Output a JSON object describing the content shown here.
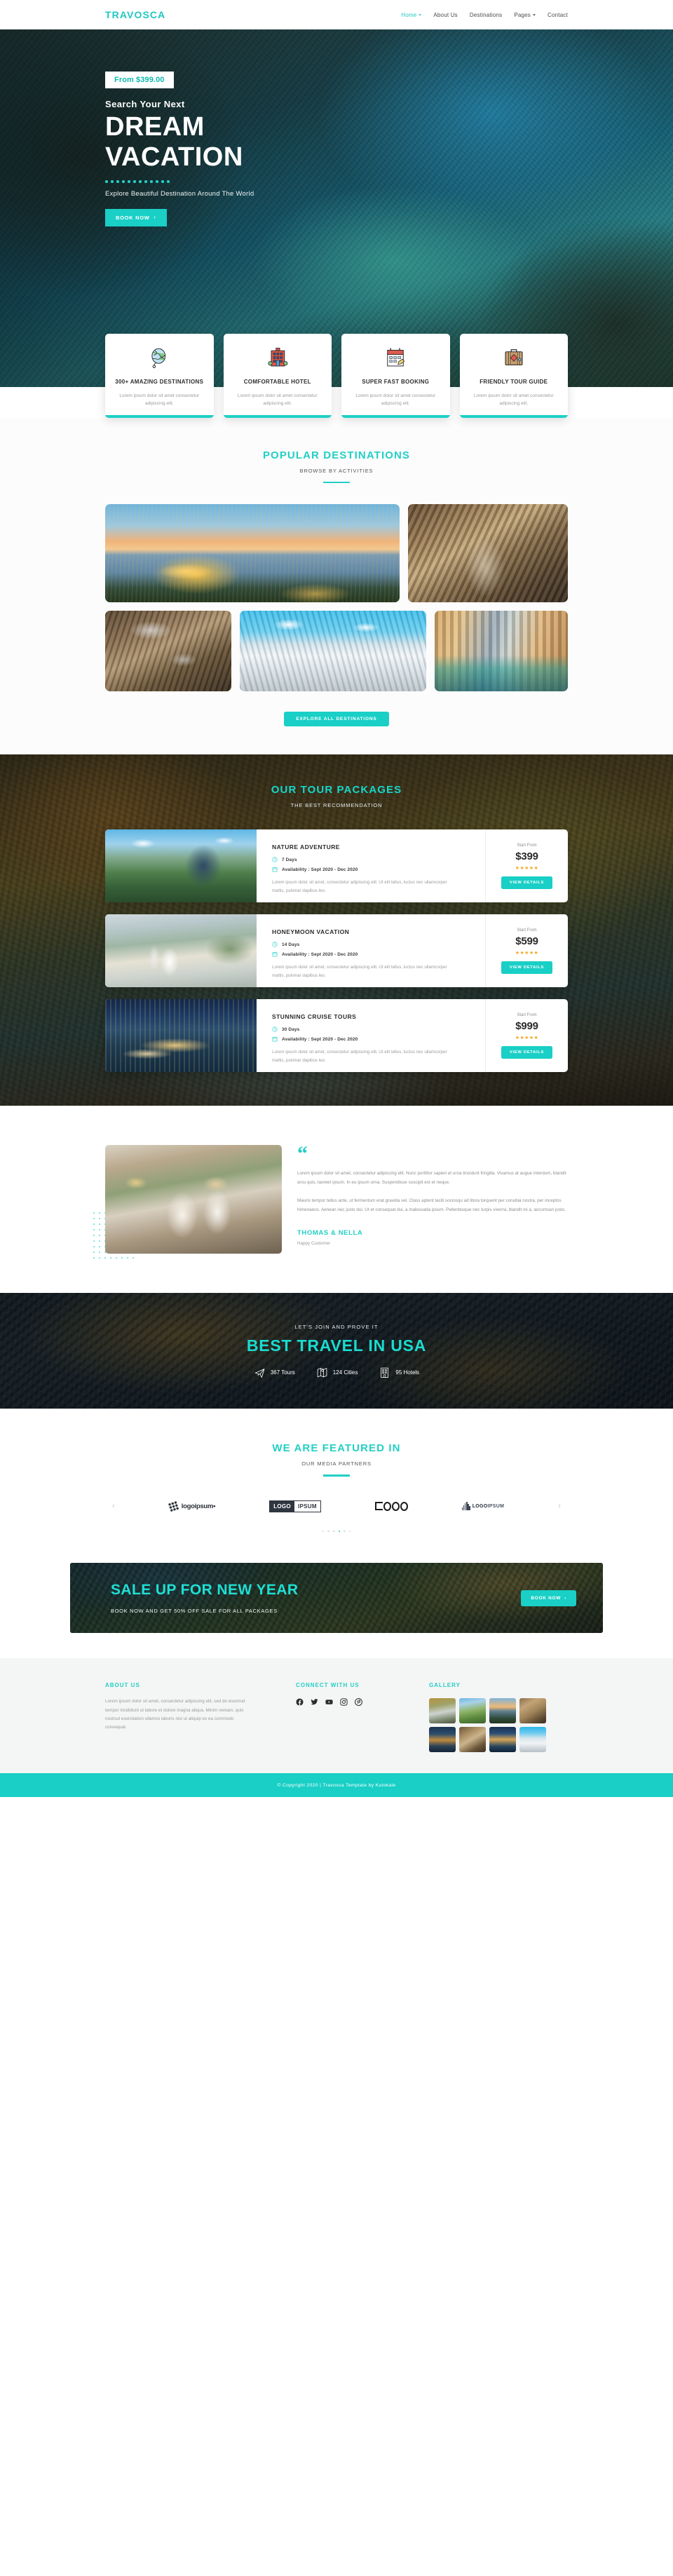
{
  "nav": {
    "brand": "TRAVOSCA",
    "links": [
      {
        "label": "Home",
        "caret": true,
        "active": true
      },
      {
        "label": "About Us",
        "caret": false,
        "active": false
      },
      {
        "label": "Destinations",
        "caret": false,
        "active": false
      },
      {
        "label": "Pages",
        "caret": true,
        "active": false
      },
      {
        "label": "Contact",
        "caret": false,
        "active": false
      }
    ]
  },
  "hero": {
    "price_badge": "From $399.00",
    "eyebrow": "Search Your Next",
    "title_line1": "DREAM",
    "title_line2": "VACATION",
    "tagline": "Explore Beautiful Destination Around The World",
    "cta": "BOOK NOW",
    "cta_arrow": "›"
  },
  "features": [
    {
      "icon": "globe-icon",
      "title": "300+ AMAZING DESTINATIONS",
      "desc": "Lorem ipsum dolor sit amet consectetur adipiscing elit."
    },
    {
      "icon": "hotel-icon",
      "title": "COMFORTABLE HOTEL",
      "desc": "Lorem ipsum dolor sit amet consectetur adipiscing elit."
    },
    {
      "icon": "calendar-icon",
      "title": "SUPER FAST BOOKING",
      "desc": "Lorem ipsum dolor sit amet consectetur adipiscing elit."
    },
    {
      "icon": "suitcase-icon",
      "title": "FRIENDLY TOUR GUIDE",
      "desc": "Lorem ipsum dolor sit amet consectetur adipiscing elit."
    }
  ],
  "destinations": {
    "title": "POPULAR DESTINATIONS",
    "subtitle": "BROWSE BY ACTIVITIES",
    "tiles": [
      {
        "name": "sveti-stefan-sunset-bay"
      },
      {
        "name": "cliff-walkway-waterfall"
      },
      {
        "name": "cave-arch-interior"
      },
      {
        "name": "snow-mountain-glacier"
      },
      {
        "name": "venice-canal-gondola"
      }
    ],
    "cta": "EXPLORE ALL DESTINATIONS"
  },
  "packages": {
    "title": "OUR TOUR PACKAGES",
    "subtitle": "THE BEST RECOMMENDATION",
    "labels": {
      "start_from": "Start From",
      "view_details": "VIEW DETAILS",
      "stars": "★★★★★"
    },
    "items": [
      {
        "name": "NATURE ADVENTURE",
        "duration": "7 Days",
        "availability": "Availability : Sept 2020 - Dec 2020",
        "desc": "Lorem ipsum dolor sit amet, consectetur adipiscing elit. Ut elit tellus, luctus nec ullamcorper mattis, pulvinar dapibus leo.",
        "price": "$399",
        "image": "norway-green-valley"
      },
      {
        "name": "HONEYMOON VACATION",
        "duration": "14 Days",
        "availability": "Availability : Sept 2020 - Dec 2020",
        "desc": "Lorem ipsum dolor sit amet, consectetur adipiscing elit. Ut elit tellus, luctus nec ullamcorper mattis, pulvinar dapibus leo.",
        "price": "$599",
        "image": "honeymoon-couple-coast"
      },
      {
        "name": "STUNNING CRUISE TOURS",
        "duration": "30 Days",
        "availability": "Availability : Sept 2020 - Dec 2020",
        "desc": "Lorem ipsum dolor sit amet, consectetur adipiscing elit. Ut elit tellus, luctus nec ullamcorper mattis, pulvinar dapibus leo.",
        "price": "$999",
        "image": "cruise-ship-night-harbor"
      }
    ]
  },
  "testimonial": {
    "quote_mark": "“",
    "paragraph1": "Lorem ipsum dolor sit amet, consectetur adipiscing elit. Nunc porttitor sapien et urna tincidunt fringilla. Vivamus at augue interdum, blandit arcu quis, laoreet ipsum. In eu ipsum urna. Suspendisse suscipit est et neque.",
    "paragraph2": "Mauris tempor tellus ante, ut fermentum erat gravida vel. Class aptent taciti sociosqu ad litora torquent per conubia nostra, per inceptos himenaeos. Aenean nec justo dui. Ut et consequat dui, a malesuada ipsum. Pellentesque nec turpis viverra, blandit mi a, accumsan justo.",
    "name": "THOMAS & NELLA",
    "role": "Happy Customer",
    "photo": "couple-with-map-street"
  },
  "stats": {
    "kicker": "LET'S JOIN AND PROVE IT",
    "title": "BEST TRAVEL IN USA",
    "items": [
      {
        "icon": "airplane-icon",
        "value": "367 Tours"
      },
      {
        "icon": "map-icon",
        "value": "124 Cities"
      },
      {
        "icon": "building-icon",
        "value": "95 Hotels"
      }
    ]
  },
  "featured": {
    "title": "WE ARE FEATURED IN",
    "subtitle": "OUR MEDIA PARTNERS",
    "prev_arrow": "‹",
    "next_arrow": "›",
    "logos": [
      {
        "id": "logo-dots-logoipsum",
        "text": "logoipsum•"
      },
      {
        "id": "logo-box-logoipsum",
        "dark": "LOGO",
        "light": "IPSUM"
      },
      {
        "id": "logo-geometric-logo",
        "text": "LOGO"
      },
      {
        "id": "logo-bars-logoipsum",
        "bold": "LOGO",
        "rest": "IPSUM"
      }
    ],
    "dots": [
      false,
      false,
      false,
      true,
      false,
      false
    ]
  },
  "sale": {
    "title": "SALE UP FOR NEW YEAR",
    "subtitle": "BOOK NOW AND GET 50% OFF SALE FOR ALL PACKAGES",
    "cta": "BOOK NOW",
    "cta_arrow": "›"
  },
  "footer": {
    "about_title": "ABOUT US",
    "about_text": "Lorem ipsum dolor sit amet, consectetur adipiscing elit, sed do eiusmod tempor incididunt ut labore et dolore magna aliqua. Minim veniam, quis nostrud exercitation ullamco laboris nisi ut aliquip ex ea commodo consequat.",
    "connect_title": "CONNECT WITH US",
    "socials": [
      "facebook-icon",
      "twitter-icon",
      "youtube-icon",
      "instagram-icon",
      "pinterest-icon"
    ],
    "gallery_title": "GALLERY",
    "gallery": [
      "gallery-autumn-path",
      "gallery-green-valley",
      "gallery-sunset-bay",
      "gallery-canyon-cliff",
      "gallery-night-town",
      "gallery-cave-arch",
      "gallery-cruise-night",
      "gallery-glacier"
    ],
    "copyright": "© Copyright 2020  |  Travosca Template by Kulokale"
  }
}
